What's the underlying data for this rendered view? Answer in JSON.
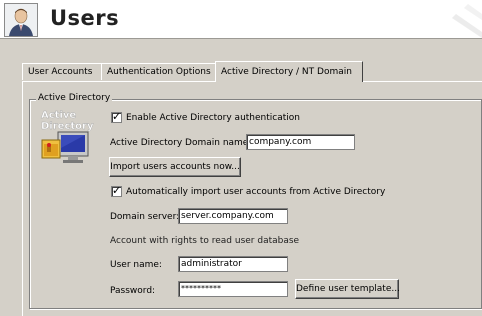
{
  "header": {
    "title": "Users"
  },
  "tabs": [
    {
      "label": "User Accounts"
    },
    {
      "label": "Authentication Options"
    },
    {
      "label": "Active Directory / NT Domain"
    }
  ],
  "group": {
    "title": "Active Directory",
    "icon_text": "Active Directory",
    "enable_ad_label": "Enable Active Directory authentication",
    "enable_ad_checked": true,
    "domain_name_label": "Active Directory Domain name:",
    "domain_name_value": "company.com",
    "import_button": "Import users accounts now...",
    "auto_import_label": "Automatically import user accounts from Active Directory",
    "auto_import_checked": true,
    "domain_server_label": "Domain server:",
    "domain_server_value": "server.company.com",
    "account_rights_label": "Account with rights to read user database",
    "username_label": "User name:",
    "username_value": "administrator",
    "password_label": "Password:",
    "password_value": "**********",
    "template_button": "Define user template..."
  },
  "colors": {
    "window_bg": "#d4d0c8",
    "header_bg": "#ffffff"
  },
  "icons": [
    "user-avatar-icon",
    "active-directory-icon",
    "checkmark-icon"
  ]
}
